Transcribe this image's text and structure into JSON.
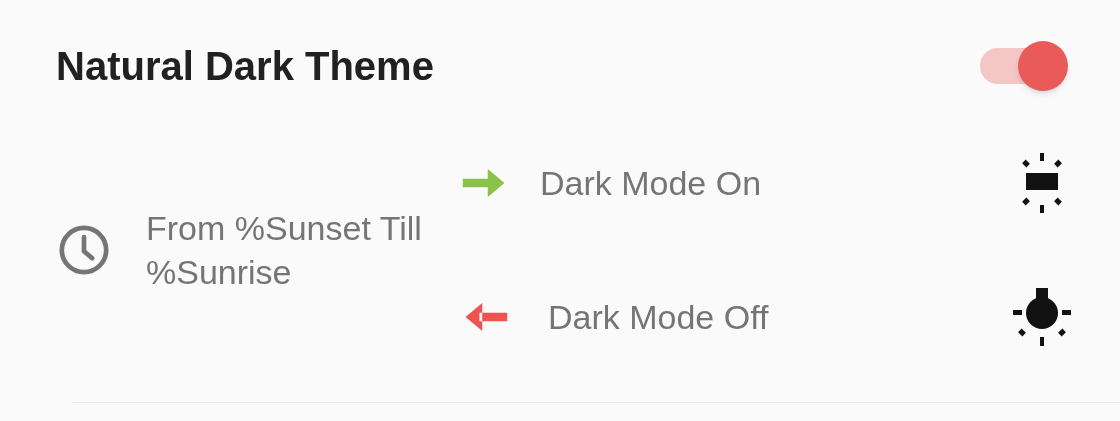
{
  "setting": {
    "title": "Natural Dark Theme",
    "on": true
  },
  "schedule": {
    "label": "From %Sunset Till %Sunrise"
  },
  "modes": [
    {
      "label": "Dark Mode On",
      "kind": "on",
      "color": "#8bc34a"
    },
    {
      "label": "Dark Mode Off",
      "kind": "off",
      "color": "#ef5350"
    }
  ]
}
